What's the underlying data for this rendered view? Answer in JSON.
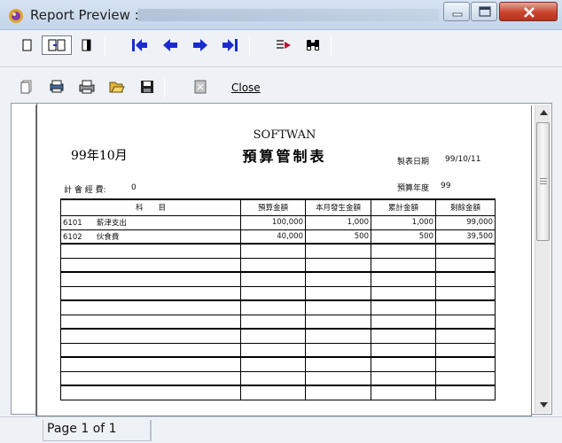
{
  "window": {
    "title": "Report Preview :"
  },
  "toolbar": {
    "close_label": "Close"
  },
  "report": {
    "company": "SOFTWAN",
    "title": "預算管制表",
    "period": "99年10月",
    "print_date_label": "製表日期",
    "print_date": "99/10/11",
    "budget_year_label": "預算年度",
    "budget_year": "99",
    "total_label": "計 會 經 費:",
    "total_value": "0",
    "columns": [
      "科　　目",
      "預算金額",
      "本月發生金額",
      "累計金額",
      "剩餘金額"
    ],
    "rows": [
      {
        "code": "6101",
        "name": "薪津支出",
        "budget": "100,000",
        "month": "1,000",
        "cumulative": "1,000",
        "remaining": "99,000"
      },
      {
        "code": "6102",
        "name": "伙食費",
        "budget": "40,000",
        "month": "500",
        "cumulative": "500",
        "remaining": "39,500"
      }
    ]
  },
  "status": {
    "page_info": "Page 1 of 1"
  },
  "colors": {
    "nav_arrow": "#1a2ccf",
    "close_button": "#c9452f"
  }
}
